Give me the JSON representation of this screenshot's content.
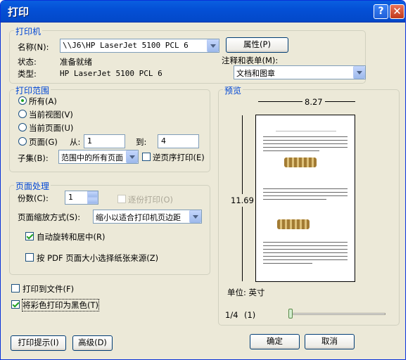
{
  "window": {
    "title": "打印",
    "help": "?",
    "close": "✕"
  },
  "printer": {
    "group_label": "打印机",
    "name_label": "名称(N):",
    "name_value": "\\\\J6\\HP LaserJet 5100 PCL 6",
    "props_button": "属性(P)",
    "status_label": "状态:",
    "status_value": "准备就绪",
    "type_label": "类型:",
    "type_value": "HP LaserJet 5100 PCL 6",
    "comments_label": "注释和表单(M):",
    "comments_value": "文档和图章"
  },
  "range": {
    "group_label": "打印范围",
    "all": "所有(A)",
    "current_view": "当前视图(V)",
    "current_page": "当前页面(U)",
    "pages": "页面(G)",
    "from_label": "从:",
    "from_value": "1",
    "to_label": "到:",
    "to_value": "4",
    "subset_label": "子集(B):",
    "subset_value": "范围中的所有页面",
    "reverse": "逆页序打印(E)"
  },
  "handling": {
    "group_label": "页面处理",
    "copies_label": "份数(C):",
    "copies_value": "1",
    "collate": "逐份打印(O)",
    "scaling_label": "页面缩放方式(S):",
    "scaling_value": "缩小以适合打印机页边距",
    "auto_rotate": "自动旋转和居中(R)",
    "pdf_page_size": "按 PDF 页面大小选择纸张来源(Z)"
  },
  "options": {
    "print_to_file": "打印到文件(F)",
    "print_color_as_black": "将彩色打印为黑色(T)"
  },
  "preview": {
    "group_label": "预览",
    "width": "8.27",
    "height": "11.69",
    "units": "单位: 英寸",
    "page_info": "1/4",
    "page_num": "(1)",
    "slider_fraction": 0
  },
  "buttons": {
    "tips": "打印提示(I)",
    "advanced": "高级(D)",
    "ok": "确定",
    "cancel": "取消"
  }
}
